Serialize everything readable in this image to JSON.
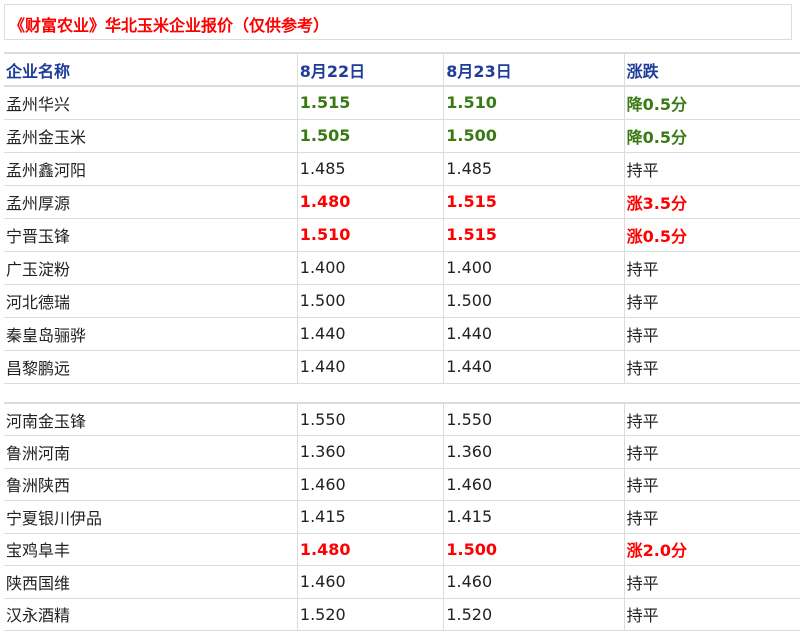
{
  "title": "《财富农业》华北玉米企业报价（仅供参考）",
  "colors": {
    "up": "#ff0000",
    "down": "#3a7a14",
    "header": "#1f3c99"
  },
  "headers": [
    "企业名称",
    "8月22日",
    "8月23日",
    "涨跌"
  ],
  "rows_a": [
    {
      "name": "孟州华兴",
      "d22": "1.515",
      "d23": "1.510",
      "chg": "降0.5分",
      "cls": "down"
    },
    {
      "name": "孟州金玉米",
      "d22": "1.505",
      "d23": "1.500",
      "chg": "降0.5分",
      "cls": "down"
    },
    {
      "name": "孟州鑫河阳",
      "d22": "1.485",
      "d23": "1.485",
      "chg": "持平",
      "cls": ""
    },
    {
      "name": "孟州厚源",
      "d22": "1.480",
      "d23": "1.515",
      "chg": "涨3.5分",
      "cls": "up"
    },
    {
      "name": "宁晋玉锋",
      "d22": "1.510",
      "d23": "1.515",
      "chg": "涨0.5分",
      "cls": "up"
    },
    {
      "name": "广玉淀粉",
      "d22": "1.400",
      "d23": "1.400",
      "chg": "持平",
      "cls": ""
    },
    {
      "name": "河北德瑞",
      "d22": "1.500",
      "d23": "1.500",
      "chg": "持平",
      "cls": ""
    },
    {
      "name": "秦皇岛骊骅",
      "d22": "1.440",
      "d23": "1.440",
      "chg": "持平",
      "cls": ""
    },
    {
      "name": "昌黎鹏远",
      "d22": "1.440",
      "d23": "1.440",
      "chg": "持平",
      "cls": ""
    }
  ],
  "rows_b": [
    {
      "name": "河南金玉锋",
      "d22": "1.550",
      "d23": "1.550",
      "chg": "持平",
      "cls": ""
    },
    {
      "name": "鲁洲河南",
      "d22": "1.360",
      "d23": "1.360",
      "chg": "持平",
      "cls": ""
    },
    {
      "name": "鲁洲陕西",
      "d22": "1.460",
      "d23": "1.460",
      "chg": "持平",
      "cls": ""
    },
    {
      "name": "宁夏银川伊品",
      "d22": "1.415",
      "d23": "1.415",
      "chg": "持平",
      "cls": ""
    },
    {
      "name": "宝鸡阜丰",
      "d22": "1.480",
      "d23": "1.500",
      "chg": "涨2.0分",
      "cls": "up"
    },
    {
      "name": "陕西国维",
      "d22": "1.460",
      "d23": "1.460",
      "chg": "持平",
      "cls": ""
    },
    {
      "name": "汉永酒精",
      "d22": "1.520",
      "d23": "1.520",
      "chg": "持平",
      "cls": ""
    }
  ]
}
